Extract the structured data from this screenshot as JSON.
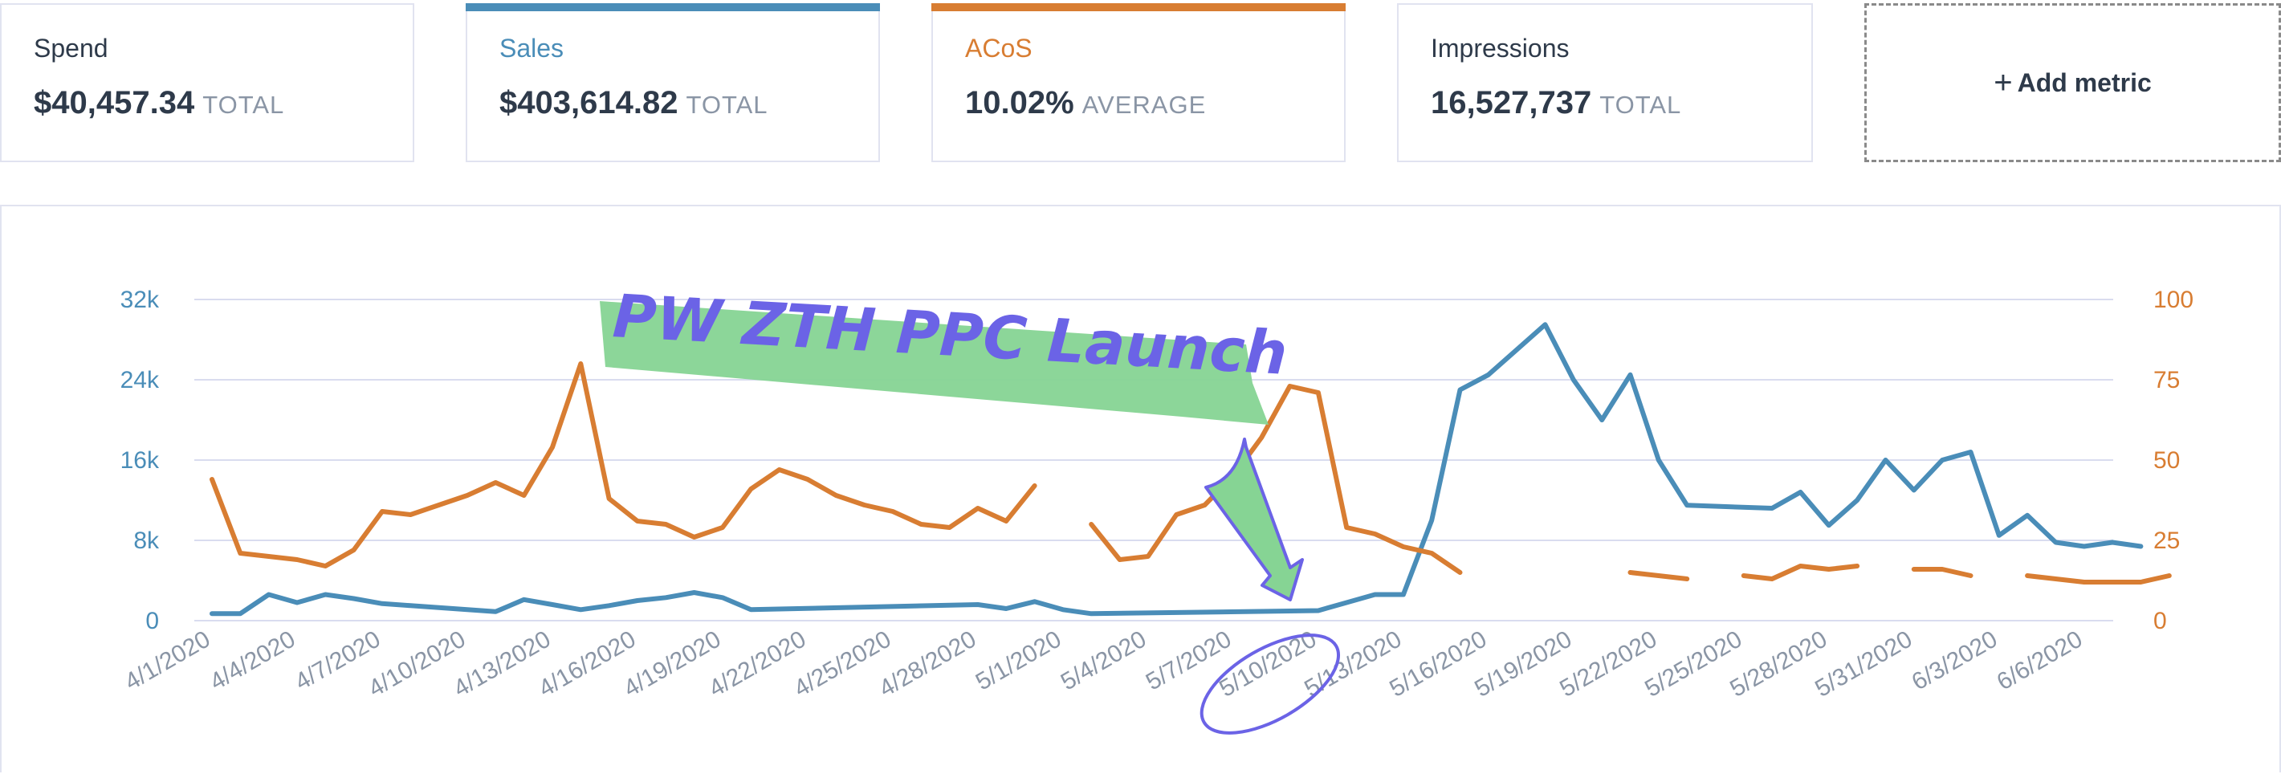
{
  "metrics": {
    "spend": {
      "label": "Spend",
      "value": "$40,457.34",
      "suffix": "TOTAL"
    },
    "sales": {
      "label": "Sales",
      "value": "$403,614.82",
      "suffix": "TOTAL",
      "color": "#4a8db8"
    },
    "acos": {
      "label": "ACoS",
      "value": "10.02%",
      "suffix": "AVERAGE",
      "color": "#d87d32"
    },
    "impressions": {
      "label": "Impressions",
      "value": "16,527,737",
      "suffix": "TOTAL"
    },
    "add_metric": {
      "icon": "plus-icon",
      "label": "Add metric"
    }
  },
  "annotation": {
    "text": "PW ZTH PPC Launch",
    "text_color": "#6b63e6",
    "highlight_color": "#86d494",
    "arrow_color": "#6b63e6",
    "circled_date": "5/10/2020"
  },
  "chart_data": {
    "type": "line",
    "x": [
      "4/1/2020",
      "4/2/2020",
      "4/3/2020",
      "4/4/2020",
      "4/5/2020",
      "4/6/2020",
      "4/7/2020",
      "4/8/2020",
      "4/9/2020",
      "4/10/2020",
      "4/11/2020",
      "4/12/2020",
      "4/13/2020",
      "4/14/2020",
      "4/15/2020",
      "4/16/2020",
      "4/17/2020",
      "4/18/2020",
      "4/19/2020",
      "4/20/2020",
      "4/21/2020",
      "4/22/2020",
      "4/23/2020",
      "4/24/2020",
      "4/25/2020",
      "4/26/2020",
      "4/27/2020",
      "4/28/2020",
      "4/29/2020",
      "4/30/2020",
      "5/1/2020",
      "5/2/2020",
      "5/3/2020",
      "5/4/2020",
      "5/5/2020",
      "5/6/2020",
      "5/7/2020",
      "5/8/2020",
      "5/9/2020",
      "5/10/2020",
      "5/11/2020",
      "5/12/2020",
      "5/13/2020",
      "5/14/2020",
      "5/15/2020",
      "5/16/2020",
      "5/17/2020",
      "5/18/2020",
      "5/19/2020",
      "5/20/2020",
      "5/21/2020",
      "5/22/2020",
      "5/23/2020",
      "5/24/2020",
      "5/25/2020",
      "5/26/2020",
      "5/27/2020",
      "5/28/2020",
      "5/29/2020",
      "5/30/2020",
      "5/31/2020",
      "6/1/2020",
      "6/2/2020",
      "6/3/2020",
      "6/4/2020",
      "6/5/2020",
      "6/6/2020"
    ],
    "x_tick_labels": [
      "4/1/2020",
      "4/4/2020",
      "4/7/2020",
      "4/10/2020",
      "4/13/2020",
      "4/16/2020",
      "4/19/2020",
      "4/22/2020",
      "4/25/2020",
      "4/28/2020",
      "5/1/2020",
      "5/4/2020",
      "5/7/2020",
      "5/10/2020",
      "5/13/2020",
      "5/16/2020",
      "5/19/2020",
      "5/22/2020",
      "5/25/2020",
      "5/28/2020",
      "5/31/2020",
      "6/3/2020",
      "6/6/2020"
    ],
    "y_left": {
      "ticks": [
        "0",
        "8k",
        "16k",
        "24k",
        "32k"
      ],
      "ylim": [
        0,
        32000
      ],
      "color": "#4a8db8"
    },
    "y_right": {
      "ticks": [
        "0",
        "25",
        "50",
        "75",
        "100"
      ],
      "ylim": [
        0,
        100
      ],
      "color": "#d87d32"
    },
    "grid": true,
    "series": [
      {
        "name": "Sales",
        "axis": "left",
        "color": "#4a8db8",
        "values": [
          700,
          700,
          2600,
          1800,
          2600,
          2200,
          1700,
          1500,
          1300,
          1100,
          900,
          2100,
          1600,
          1100,
          1500,
          2000,
          2300,
          2800,
          2300,
          1100,
          null,
          null,
          null,
          null,
          null,
          null,
          null,
          1600,
          1200,
          1900,
          1100,
          700,
          null,
          null,
          null,
          null,
          null,
          null,
          null,
          1000,
          1800,
          2600,
          2600,
          10000,
          23000,
          24500,
          27000,
          29500,
          24000,
          20000,
          24500,
          16000,
          11500,
          null,
          null,
          11200,
          12800,
          9500,
          12000,
          16000,
          13000,
          16000,
          16800,
          8500,
          10500,
          7800,
          7400,
          7800,
          7400
        ]
      },
      {
        "name": "ACoS",
        "axis": "right",
        "color": "#d87d32",
        "values": [
          44,
          21,
          20,
          19,
          17,
          22,
          34,
          33,
          36,
          39,
          43,
          39,
          54,
          80,
          38,
          31,
          30,
          26,
          29,
          41,
          47,
          44,
          39,
          36,
          34,
          30,
          29,
          35,
          31,
          42,
          null,
          30,
          19,
          20,
          33,
          36,
          45,
          57,
          73,
          71,
          29,
          27,
          23,
          21,
          15,
          null,
          14,
          null,
          15,
          null,
          15,
          14,
          13,
          null,
          14,
          13,
          17,
          16,
          17,
          null,
          16,
          16,
          14,
          null,
          14,
          13,
          12,
          12,
          12,
          14
        ]
      }
    ]
  }
}
